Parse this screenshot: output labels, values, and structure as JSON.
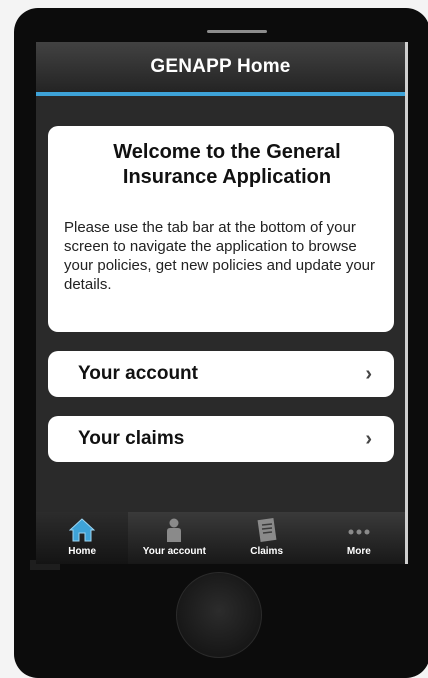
{
  "header": {
    "title": "GENAPP Home"
  },
  "welcome": {
    "title": "Welcome to the General Insurance Application",
    "body": "Please use the tab bar at the bottom of your screen to navigate the application to browse your policies, get new policies and update your details."
  },
  "menu": {
    "items": [
      {
        "label": "Your account",
        "chevron": "›"
      },
      {
        "label": "Your claims",
        "chevron": "›"
      }
    ]
  },
  "tabbar": {
    "tabs": [
      {
        "label": "Home",
        "icon": "home-icon",
        "active": true
      },
      {
        "label": "Your account",
        "icon": "person-icon",
        "active": false
      },
      {
        "label": "Claims",
        "icon": "document-icon",
        "active": false
      },
      {
        "label": "More",
        "icon": "more-icon",
        "active": false
      }
    ]
  },
  "colors": {
    "accent": "#3ea3d8",
    "header_bg": "#333333",
    "card_bg": "#ffffff",
    "screen_bg": "#2a2a2a",
    "phone_body": "#0c0c0c"
  }
}
